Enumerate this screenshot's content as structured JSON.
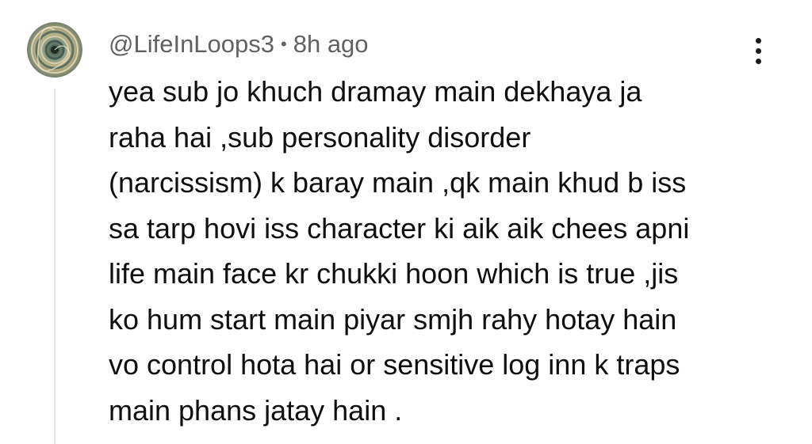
{
  "comment": {
    "author": "@LifeInLoops3",
    "separator": "•",
    "time": "8h ago",
    "text_lines": [
      "yea sub jo khuch dramay main dekhaya ja",
      "raha hai ,sub personality disorder",
      "(narcissism) k baray main ,qk main khud b iss",
      "sa tarp hovi iss character ki aik aik chees apni",
      "life main face kr chukki hoon which is true ,jis",
      "ko hum start main piyar smjh rahy hotay hain",
      "vo control hota hai or sensitive log inn k traps",
      "main phans jatay hain ."
    ],
    "menu_icon": "more-vertical-icon",
    "avatar_icon": "spiral-avatar"
  }
}
